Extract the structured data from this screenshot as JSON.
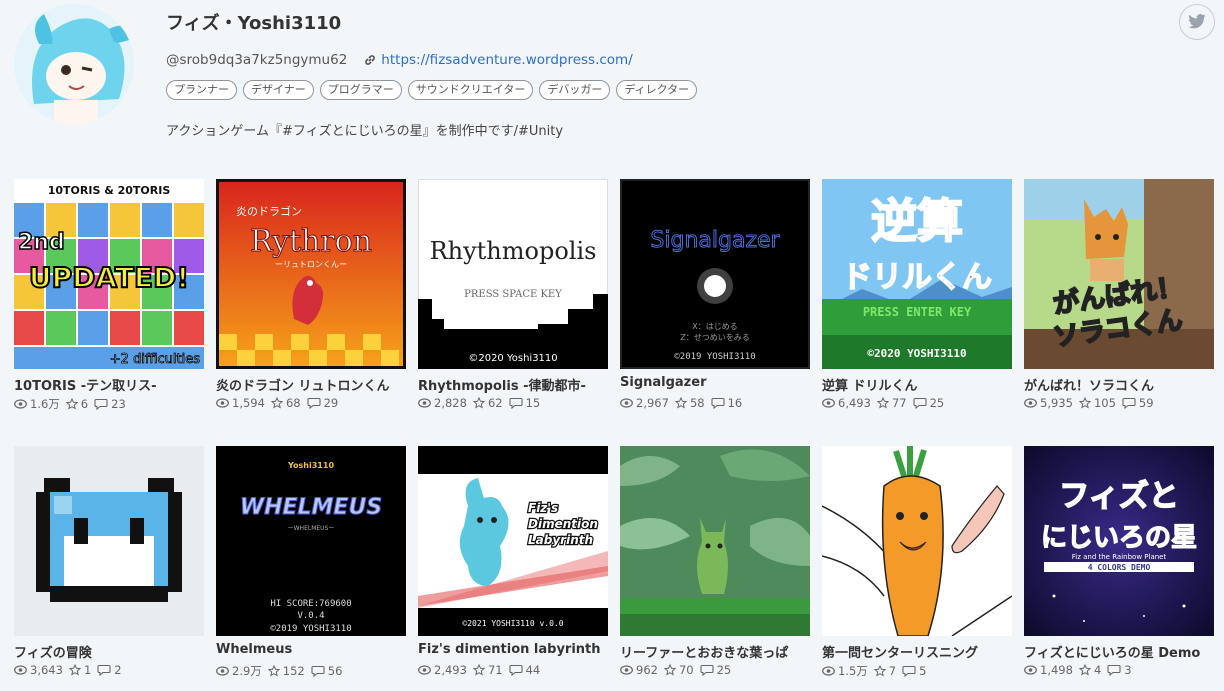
{
  "profile": {
    "name": "フィズ・Yoshi3110",
    "handle": "@srob9dq3a7kz5ngymu62",
    "website": "https://fizsadventure.wordpress.com/",
    "tags": [
      "プランナー",
      "デザイナー",
      "プログラマー",
      "サウンドクリエイター",
      "デバッガー",
      "ディレクター"
    ],
    "bio": "アクションゲーム『#フィズとにじいろの星』を制作中です/#Unity"
  },
  "games": [
    {
      "title": "10TORIS -テン取リス-",
      "views": "1.6万",
      "stars": "6",
      "comments": "23",
      "thumb_text": [
        "10TORIS & 20TORIS",
        "2nd",
        "UPDATED!",
        "+2 difficulties"
      ]
    },
    {
      "title": "炎のドラゴン リュトロンくん",
      "views": "1,594",
      "stars": "68",
      "comments": "29",
      "thumb_text": [
        "炎のドラゴン",
        "Rythron",
        "ーリュトロンくんー"
      ]
    },
    {
      "title": "Rhythmopolis -律動都市-",
      "views": "2,828",
      "stars": "62",
      "comments": "15",
      "thumb_text": [
        "Rhythmopolis",
        "PRESS SPACE KEY",
        "©2020 Yoshi3110"
      ]
    },
    {
      "title": "Signalgazer",
      "views": "2,967",
      "stars": "58",
      "comments": "16",
      "thumb_text": [
        "Signalgazer",
        "X：はじめる",
        "Z：せつめいをみる",
        "©2019 YOSHI3110"
      ]
    },
    {
      "title": "逆算 ドリルくん",
      "views": "6,493",
      "stars": "77",
      "comments": "25",
      "thumb_text": [
        "逆算",
        "ドリルくん",
        "PRESS ENTER KEY",
        "©2020 YOSHI3110"
      ]
    },
    {
      "title": "がんばれ！ソラコくん",
      "views": "5,935",
      "stars": "105",
      "comments": "59",
      "thumb_text": [
        "がんばれ！",
        "ソラコくん"
      ]
    },
    {
      "title": "フィズの冒険",
      "views": "3,643",
      "stars": "1",
      "comments": "2",
      "thumb_text": []
    },
    {
      "title": "Whelmeus",
      "views": "2.9万",
      "stars": "152",
      "comments": "56",
      "thumb_text": [
        "Yoshi3110",
        "WHELMEUS",
        "ーWHELMEUSー",
        "HI SCORE:769600",
        "V.0.4",
        "©2019 YOSHI3110"
      ]
    },
    {
      "title": "Fiz's dimention labyrinth",
      "views": "2,493",
      "stars": "71",
      "comments": "44",
      "thumb_text": [
        "Fiz's",
        "Dimention",
        "Labyrinth",
        "©2021 YOSHI3110 v.0.0"
      ]
    },
    {
      "title": "リーファーとおおきな葉っぱ",
      "views": "962",
      "stars": "70",
      "comments": "25",
      "thumb_text": []
    },
    {
      "title": "第一問センターリスニング",
      "views": "1.5万",
      "stars": "7",
      "comments": "5",
      "thumb_text": []
    },
    {
      "title": "フィズとにじいろの星 Demo",
      "views": "1,498",
      "stars": "4",
      "comments": "3",
      "thumb_text": [
        "フィズと",
        "にじいろの星",
        "Fiz and the Rainbow Planet",
        "4 COLORS DEMO"
      ]
    }
  ],
  "colors": {
    "link": "#2a6fcc",
    "text": "#333333",
    "background": "#f3f6f9"
  }
}
